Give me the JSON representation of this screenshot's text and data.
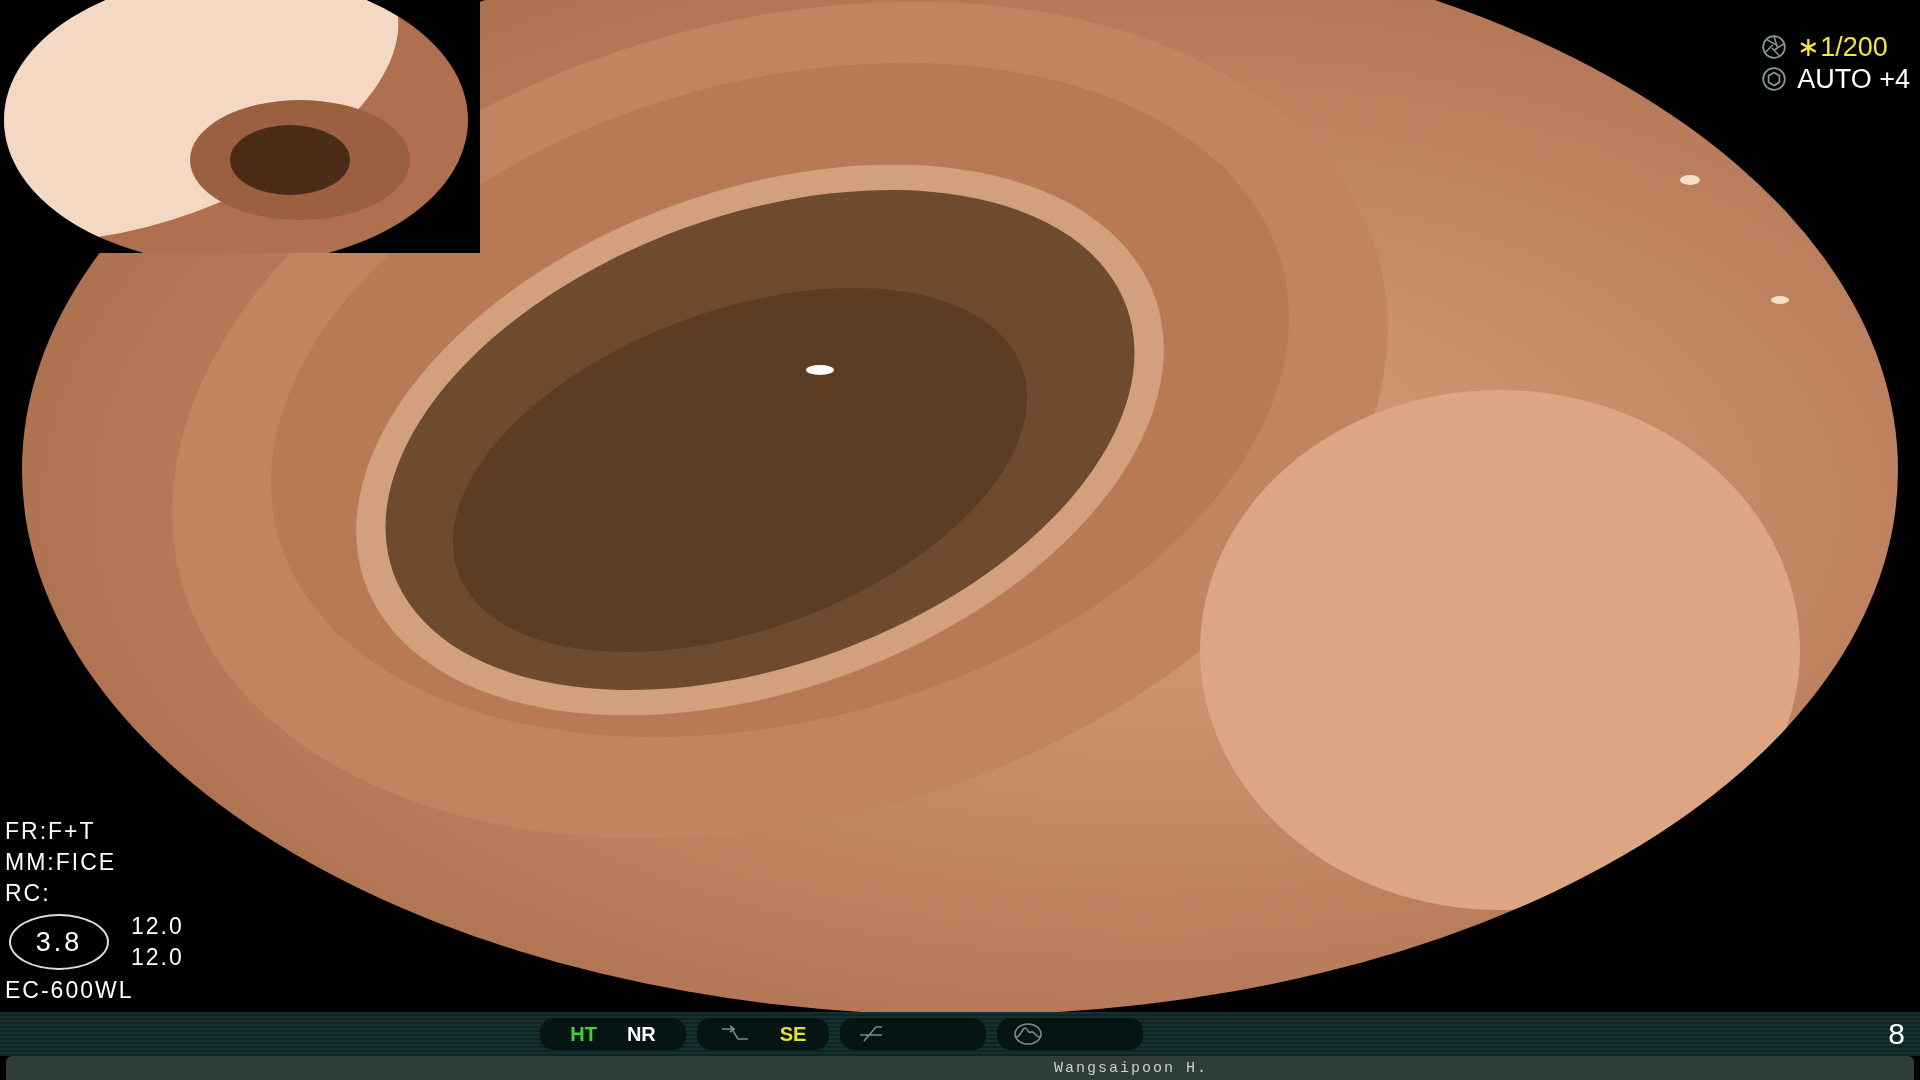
{
  "exposure": [
    {
      "kind": "shutter",
      "text": "∗1/200",
      "color": "#f2e63a"
    },
    {
      "kind": "iris",
      "text": "AUTO +4",
      "color": "#ffffff"
    }
  ],
  "settings": [
    "FR:F+T",
    "MM:FICE",
    "RC:"
  ],
  "indicator": {
    "value": "3.8",
    "readings": [
      "12.0",
      "12.0"
    ]
  },
  "scope_model": "EC-600WL",
  "status_bar": {
    "groups": [
      {
        "items": [
          {
            "kind": "text",
            "text": "HT",
            "color": "#3fcf3f"
          },
          {
            "kind": "text",
            "text": "NR",
            "color": "#ffffff"
          }
        ]
      },
      {
        "items": [
          {
            "kind": "curve"
          },
          {
            "kind": "text",
            "text": "SE",
            "color": "#e8e030"
          }
        ]
      },
      {
        "items": [
          {
            "kind": "slash"
          }
        ]
      },
      {
        "items": [
          {
            "kind": "wave"
          }
        ]
      }
    ],
    "number": "8"
  },
  "footer": {
    "name": "Wangsaipoon H."
  }
}
